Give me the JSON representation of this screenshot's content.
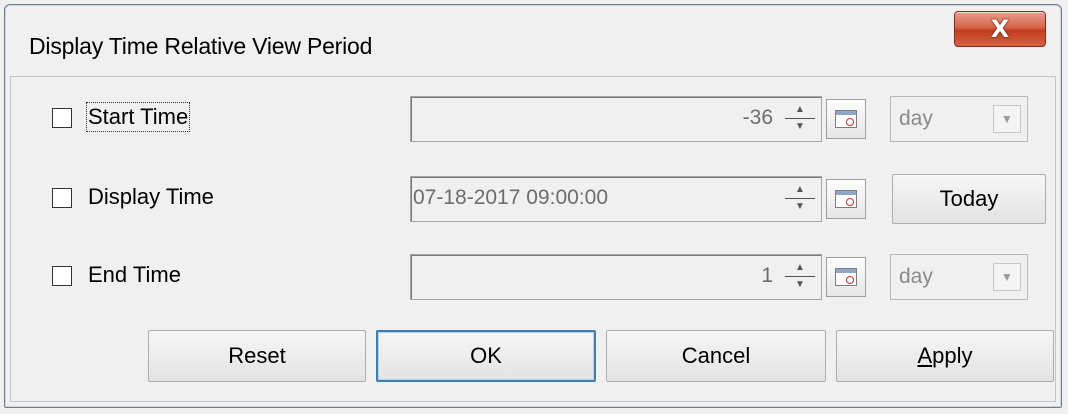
{
  "dialog": {
    "title": "Display Time  Relative View Period",
    "close_label": "X"
  },
  "rows": [
    {
      "label": "Start Time",
      "checked": false,
      "value": "-36",
      "unit": "day"
    },
    {
      "label": "Display Time",
      "checked": false,
      "value": "07-18-2017 09:00:00",
      "button": "Today"
    },
    {
      "label": "End Time",
      "checked": false,
      "value": "1",
      "unit": "day"
    }
  ],
  "buttons": {
    "reset": "Reset",
    "ok": "OK",
    "cancel": "Cancel",
    "apply_mnemonic": "A",
    "apply_rest": "pply"
  },
  "icons": {
    "spin_up": "▲",
    "spin_down": "▼",
    "dropdown": "▼"
  }
}
